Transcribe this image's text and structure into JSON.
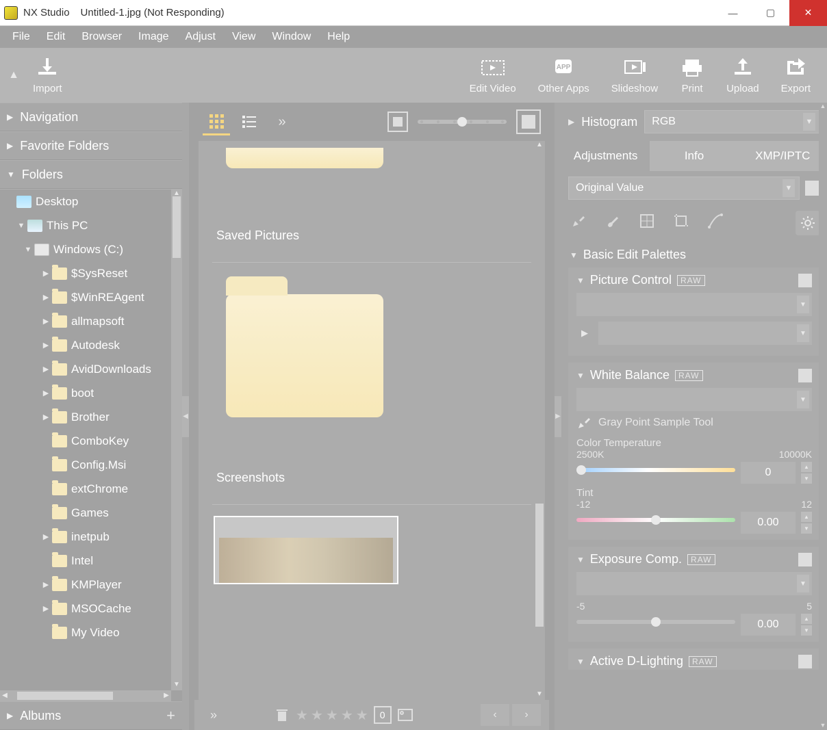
{
  "titlebar": {
    "app_name": "NX Studio",
    "file_name": "Untitled-1.jpg (Not Responding)"
  },
  "menubar": {
    "items": [
      "File",
      "Edit",
      "Browser",
      "Image",
      "Adjust",
      "View",
      "Window",
      "Help"
    ]
  },
  "toolbar": {
    "import": "Import",
    "edit_video": "Edit Video",
    "other_apps": "Other Apps",
    "slideshow": "Slideshow",
    "print": "Print",
    "upload": "Upload",
    "export": "Export"
  },
  "left": {
    "navigation": "Navigation",
    "favorite_folders": "Favorite Folders",
    "folders": "Folders",
    "albums": "Albums",
    "tree": [
      {
        "indent": 0,
        "exp": "none",
        "icon": "desktop",
        "label": "Desktop"
      },
      {
        "indent": 0,
        "exp": "down",
        "icon": "pc",
        "label": "This PC",
        "pad": 22
      },
      {
        "indent": 1,
        "exp": "down",
        "icon": "drive",
        "label": "Windows (C:)"
      },
      {
        "indent": 2,
        "exp": "right",
        "icon": "folder",
        "label": "$SysReset"
      },
      {
        "indent": 2,
        "exp": "right",
        "icon": "folder",
        "label": "$WinREAgent"
      },
      {
        "indent": 2,
        "exp": "right",
        "icon": "folder",
        "label": "allmapsoft"
      },
      {
        "indent": 2,
        "exp": "right",
        "icon": "folder",
        "label": "Autodesk"
      },
      {
        "indent": 2,
        "exp": "right",
        "icon": "folder",
        "label": "AvidDownloads"
      },
      {
        "indent": 2,
        "exp": "right",
        "icon": "folder",
        "label": "boot"
      },
      {
        "indent": 2,
        "exp": "right",
        "icon": "folder",
        "label": "Brother"
      },
      {
        "indent": 2,
        "exp": "none",
        "icon": "folder",
        "label": "ComboKey"
      },
      {
        "indent": 2,
        "exp": "none",
        "icon": "folder",
        "label": "Config.Msi"
      },
      {
        "indent": 2,
        "exp": "none",
        "icon": "folder",
        "label": "extChrome"
      },
      {
        "indent": 2,
        "exp": "none",
        "icon": "folder",
        "label": "Games"
      },
      {
        "indent": 2,
        "exp": "right",
        "icon": "folder",
        "label": "inetpub"
      },
      {
        "indent": 2,
        "exp": "none",
        "icon": "folder",
        "label": "Intel"
      },
      {
        "indent": 2,
        "exp": "right",
        "icon": "folder",
        "label": "KMPlayer"
      },
      {
        "indent": 2,
        "exp": "right",
        "icon": "folder",
        "label": "MSOCache"
      },
      {
        "indent": 2,
        "exp": "none",
        "icon": "folder",
        "label": "My Video"
      }
    ]
  },
  "center": {
    "saved_pictures": "Saved Pictures",
    "screenshots": "Screenshots",
    "rating_count": "0"
  },
  "right": {
    "histogram": "Histogram",
    "histogram_mode": "RGB",
    "tabs": {
      "adjustments": "Adjustments",
      "info": "Info",
      "xmp": "XMP/IPTC"
    },
    "original_value": "Original Value",
    "basic_edit": "Basic Edit Palettes",
    "picture_control": "Picture Control",
    "white_balance": "White Balance",
    "gray_point": "Gray Point Sample Tool",
    "color_temp": "Color Temperature",
    "temp_min": "2500K",
    "temp_max": "10000K",
    "temp_value": "0",
    "tint": "Tint",
    "tint_min": "-12",
    "tint_max": "12",
    "tint_value": "0.00",
    "exposure_comp": "Exposure Comp.",
    "exp_min": "-5",
    "exp_max": "5",
    "exp_value": "0.00",
    "active_d": "Active D-Lighting",
    "raw": "RAW"
  }
}
